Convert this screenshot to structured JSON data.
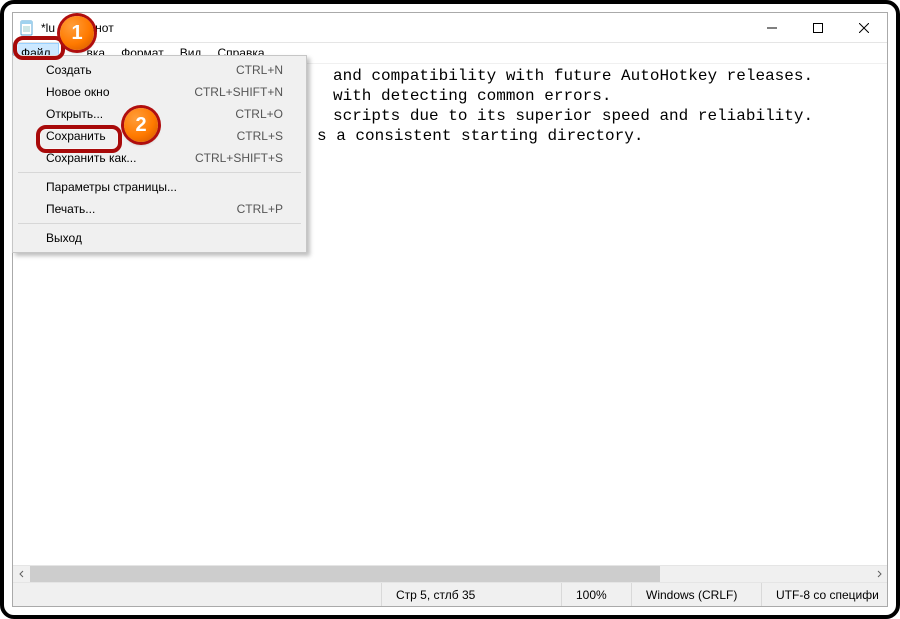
{
  "title": "*lu            – Блокнот",
  "menubar": {
    "file": "Файл",
    "edit": "вка",
    "format": "Формат",
    "view": "Вид",
    "help": "Справка"
  },
  "dropdown": {
    "items": [
      {
        "label": "Создать",
        "shortcut": "CTRL+N"
      },
      {
        "label": "Новое окно",
        "shortcut": "CTRL+SHIFT+N"
      },
      {
        "label": "Открыть...",
        "shortcut": "CTRL+O"
      },
      {
        "label": "Сохранить",
        "shortcut": "CTRL+S"
      },
      {
        "label": "Сохранить как...",
        "shortcut": "CTRL+SHIFT+S"
      },
      {
        "sep": true
      },
      {
        "label": "Параметры страницы...",
        "shortcut": ""
      },
      {
        "label": "Печать...",
        "shortcut": "CTRL+P"
      },
      {
        "sep": true
      },
      {
        "label": "Выход",
        "shortcut": ""
      }
    ]
  },
  "content": {
    "lines": [
      "and compatibility with future AutoHotkey releases.",
      "with detecting common errors.",
      "scripts due to its superior speed and reliability.",
      "s a consistent starting directory."
    ]
  },
  "status": {
    "cursor": "Стр 5, стлб 35",
    "zoom": "100%",
    "eol": "Windows (CRLF)",
    "encoding": "UTF-8 со специфи"
  },
  "annotations": {
    "marker1": "1",
    "marker2": "2"
  }
}
